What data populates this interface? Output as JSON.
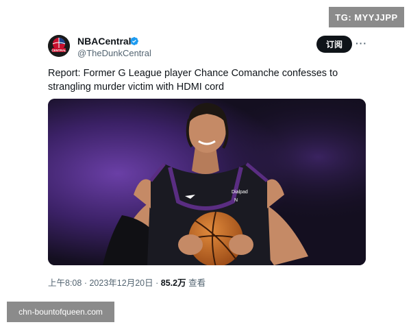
{
  "watermarks": {
    "top_right": "TG: MYYJJPP",
    "bottom_left": "chn-bountofqueen.com"
  },
  "tweet": {
    "display_name": "NBACentral",
    "handle": "@TheDunkCentral",
    "avatar_text": "CENTRAL",
    "subscribe_label": "订阅",
    "more_label": "···",
    "text": "Report: Former G League player Chance Comanche confesses to strangling murder victim with HDMI cord",
    "jersey_text": "Dialpad",
    "jersey_number": "N",
    "time": "上午8:08",
    "date": "2023年12月20日",
    "separator": "·",
    "views": "85.2万",
    "views_label": "查看"
  },
  "colors": {
    "verified": "#1d9bf0",
    "jersey_purple": "#5a2d82",
    "watermark_bg": "#8b8b8b"
  }
}
